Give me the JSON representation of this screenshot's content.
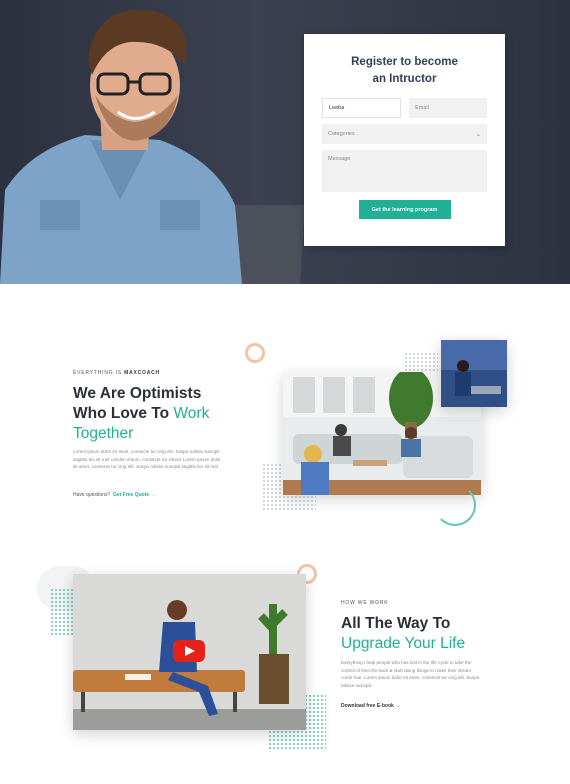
{
  "register_form": {
    "title_line1": "Register to become",
    "title_line2": "an Intructor",
    "name_value": "Leeba",
    "email_placeholder": "Email",
    "categories_placeholder": "Categories",
    "message_placeholder": "Message",
    "submit_label": "Get the learning program"
  },
  "about": {
    "eyebrow_prefix": "EVERYTHING IS ",
    "eyebrow_brand": "MAXCOACH",
    "heading_line1": "We Are Optimists",
    "heading_line2_plain": "Who Love To ",
    "heading_line2_accent": "Work",
    "heading_line3_accent": "Together",
    "body": "Lorem ipsum dolor sit amet, consecte tur cing elit. Suspe ndisse suscipit sagittis leo sit met condim entum, consecte tur cinecit Lorem ipsum dolor sit amet, consecte tur cing elit. Suspe ndisse suscipit sagittis leo sit met",
    "question": "Have questions?",
    "cta": "Get Free Quote",
    "cta_arrow": "→"
  },
  "how": {
    "eyebrow": "HOW WE WORK",
    "heading_line1": "All The Way To",
    "heading_line2_accent": "Upgrade Your Life",
    "body": "Everything I help people who has lost in the life cycle to take the control of their life back & start doing things to make their dream come true. Lorem ipsum dolor sit amet, consecte tur cing elit. Suspe ndisse suscipit.",
    "cta": "Download free E-book",
    "cta_arrow": "→"
  },
  "colors": {
    "accent": "#20b096",
    "ring_orange": "#f0c4a8",
    "youtube_red": "#e62117"
  }
}
